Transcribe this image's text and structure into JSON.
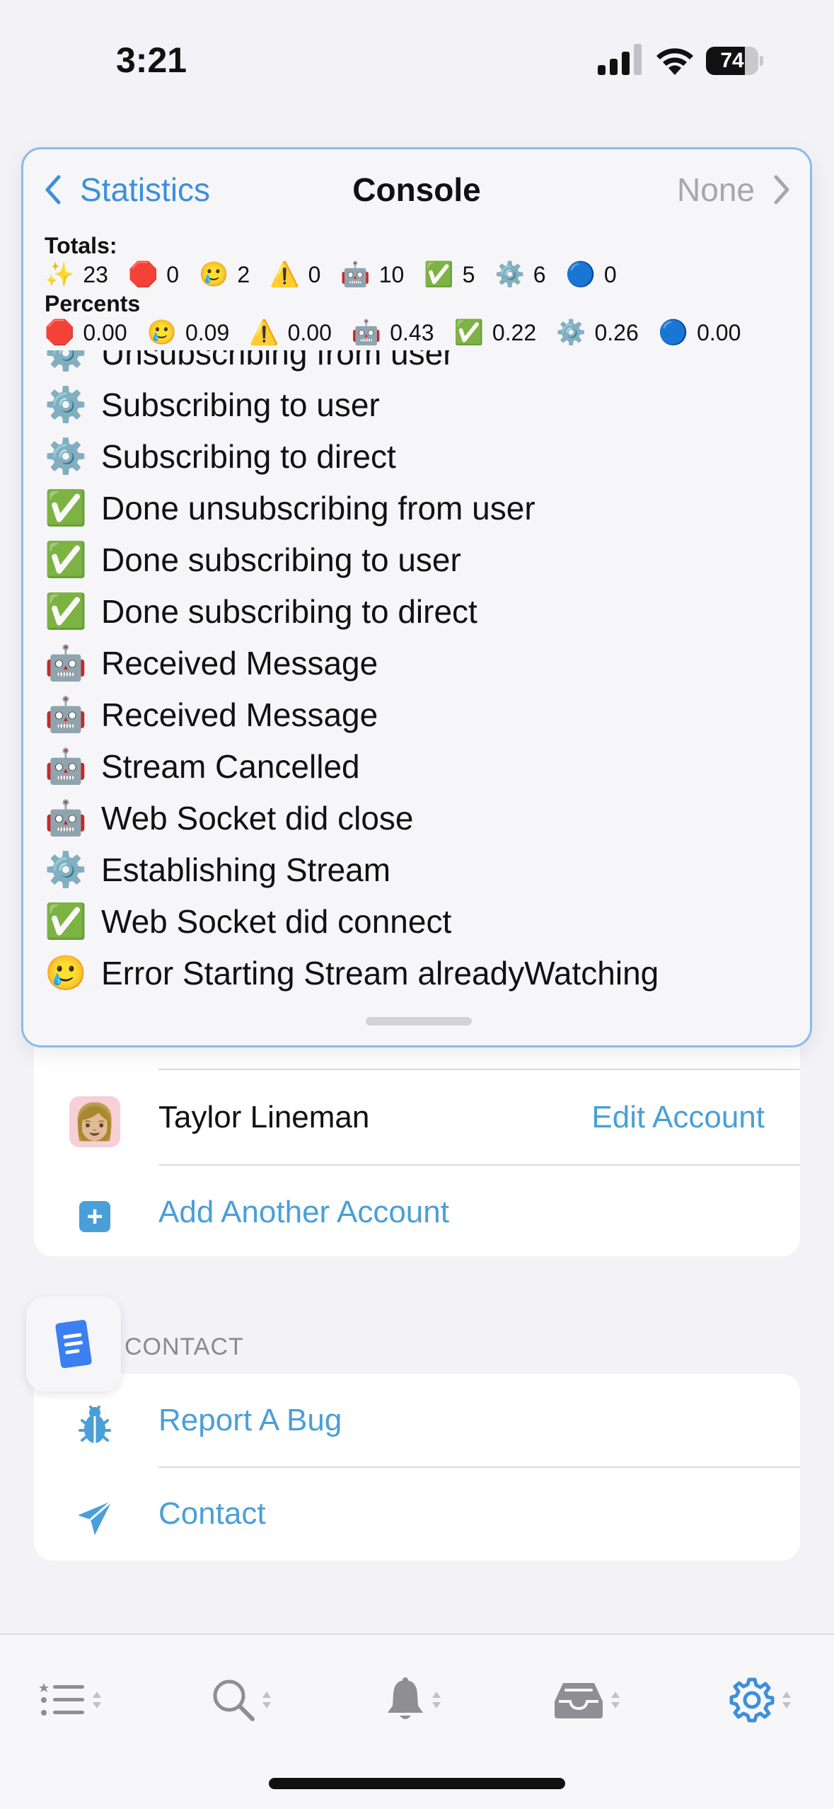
{
  "status_bar": {
    "time": "3:21",
    "battery": "74",
    "battery_fraction": 0.74
  },
  "console": {
    "back_label": "Statistics",
    "title": "Console",
    "filter_label": "None",
    "totals_label": "Totals:",
    "totals": [
      {
        "emoji": "✨",
        "value": "23"
      },
      {
        "emoji": "🛑",
        "value": "0"
      },
      {
        "emoji": "🥲",
        "value": "2"
      },
      {
        "emoji": "⚠️",
        "value": "0"
      },
      {
        "emoji": "🤖",
        "value": "10"
      },
      {
        "emoji": "✅",
        "value": "5"
      },
      {
        "emoji": "⚙️",
        "value": "6"
      },
      {
        "emoji": "🔵",
        "value": "0"
      }
    ],
    "percents_label": "Percents",
    "percents": [
      {
        "emoji": "🛑",
        "value": "0.00"
      },
      {
        "emoji": "🥲",
        "value": "0.09"
      },
      {
        "emoji": "⚠️",
        "value": "0.00"
      },
      {
        "emoji": "🤖",
        "value": "0.43"
      },
      {
        "emoji": "✅",
        "value": "0.22"
      },
      {
        "emoji": "⚙️",
        "value": "0.26"
      },
      {
        "emoji": "🔵",
        "value": "0.00"
      }
    ],
    "log": [
      {
        "emoji": "⚙️",
        "text": "Unsubscribing from user"
      },
      {
        "emoji": "⚙️",
        "text": "Subscribing to user"
      },
      {
        "emoji": "⚙️",
        "text": "Subscribing to direct"
      },
      {
        "emoji": "✅",
        "text": "Done unsubscribing from user"
      },
      {
        "emoji": "✅",
        "text": "Done subscribing to user"
      },
      {
        "emoji": "✅",
        "text": "Done subscribing to direct"
      },
      {
        "emoji": "🤖",
        "text": "Received Message"
      },
      {
        "emoji": "🤖",
        "text": "Received Message"
      },
      {
        "emoji": "🤖",
        "text": "Stream Cancelled"
      },
      {
        "emoji": "🤖",
        "text": "Web Socket did close"
      },
      {
        "emoji": "⚙️",
        "text": "Establishing Stream"
      },
      {
        "emoji": "✅",
        "text": "Web Socket did connect"
      },
      {
        "emoji": "🥲",
        "text": "Error Starting Stream alreadyWatching"
      }
    ]
  },
  "accounts": {
    "current_user": {
      "avatar": "👩🏼",
      "name": "Taylor Lineman",
      "action": "Edit Account"
    },
    "add_account_label": "Add Another Account"
  },
  "contact_section": {
    "header": "CONTACT",
    "items": [
      {
        "icon": "ladybug-icon",
        "label": "Report A Bug"
      },
      {
        "icon": "paperplane-icon",
        "label": "Contact"
      }
    ]
  },
  "tabbar": {
    "tabs": [
      {
        "icon": "list-star-icon",
        "active": false
      },
      {
        "icon": "search-icon",
        "active": false
      },
      {
        "icon": "bell-icon",
        "active": false
      },
      {
        "icon": "inbox-tray-icon",
        "active": false
      },
      {
        "icon": "gear-icon",
        "active": true
      }
    ],
    "active_color": "#3d8fdd",
    "inactive_color": "#8e8e93"
  }
}
